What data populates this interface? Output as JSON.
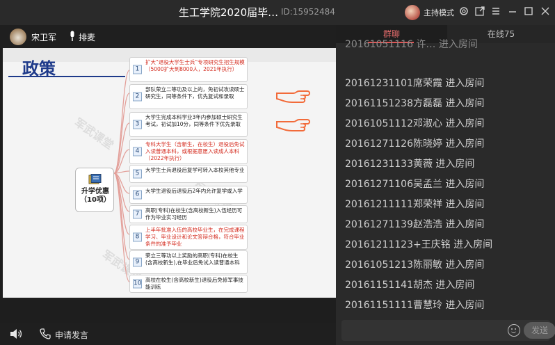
{
  "window": {
    "title": "生工学院2020届毕…",
    "room_id": "ID:15952484",
    "host_mode": "主持模式"
  },
  "teacher": {
    "name": "宋卫军",
    "mic_label": "排麦"
  },
  "slide": {
    "title": "政策",
    "center_label_line1": "升学优惠",
    "center_label_line2": "（10项）",
    "watermark": "军武课堂",
    "items": [
      {
        "num": "1",
        "text": "扩大“退役大学生士兵”专项研究生招生规模（5000扩大到8000人，2021年执行）",
        "color": "red"
      },
      {
        "num": "2",
        "text": "部队荣立二等功及以上的，免初试攻读硕士研究生，同等条件下，优先复试和录取",
        "color": "black"
      },
      {
        "num": "3",
        "text": "大学生完成本科学业3年内参加硕士研究生考试，初试加10分，同等条件下优先录取",
        "color": "black"
      },
      {
        "num": "4",
        "text": "专科大学生（含新生，在校生）退役后免试入读普通本科，或根据意愿入读成人本科（2022年执行）",
        "color": "red"
      },
      {
        "num": "5",
        "text": "大学生士兵退役后复学可转入本校其他专业",
        "color": "black"
      },
      {
        "num": "6",
        "text": "大学生退役后退役后2年内允许复学或入学",
        "color": "black"
      },
      {
        "num": "7",
        "text": "高职(专科)在校生(含高校新生)入伍经历可作为毕业实习经历",
        "color": "black"
      },
      {
        "num": "8",
        "text": "上半年批准入伍的高校毕业生，在完成课程学习、毕业设计和论文答辩合格，符合毕业条件的准予毕业",
        "color": "red"
      },
      {
        "num": "9",
        "text": "荣立三等功以上奖励的高职(专科)在校生(含高校新生),在毕业后免试入读普通本科",
        "color": "black"
      },
      {
        "num": "10",
        "text": "高校在校生(含高校新生)退役后免修军事技能训练",
        "color": "black"
      }
    ]
  },
  "bottom": {
    "apply_label": "申请发言"
  },
  "panel": {
    "tab_chat": "群聊",
    "tab_online": "在线75",
    "messages": [
      "20161051116  许… 进入房间",
      "20161231101席荣霞 进入房间",
      "20161151238方磊磊 进入房间",
      "20161051112邓淑心 进入房间",
      "20161271126陈晓婷 进入房间",
      "20161231133黄薇 进入房间",
      "20161271106吴孟兰 进入房间",
      "20161211111郑荣祥 进入房间",
      "20161271139赵浩浩 进入房间",
      "20161211123+王庆铭 进入房间",
      "20161051213陈丽敏 进入房间",
      "20161151141胡杰 进入房间",
      "20161151111曹慧玲 进入房间"
    ],
    "send_label": "发送"
  },
  "colors": {
    "accent_red": "#e05656",
    "slide_title_blue": "#1e3a8a",
    "highlight_red": "#d42a1d",
    "hand_orange": "#f26b3a"
  }
}
